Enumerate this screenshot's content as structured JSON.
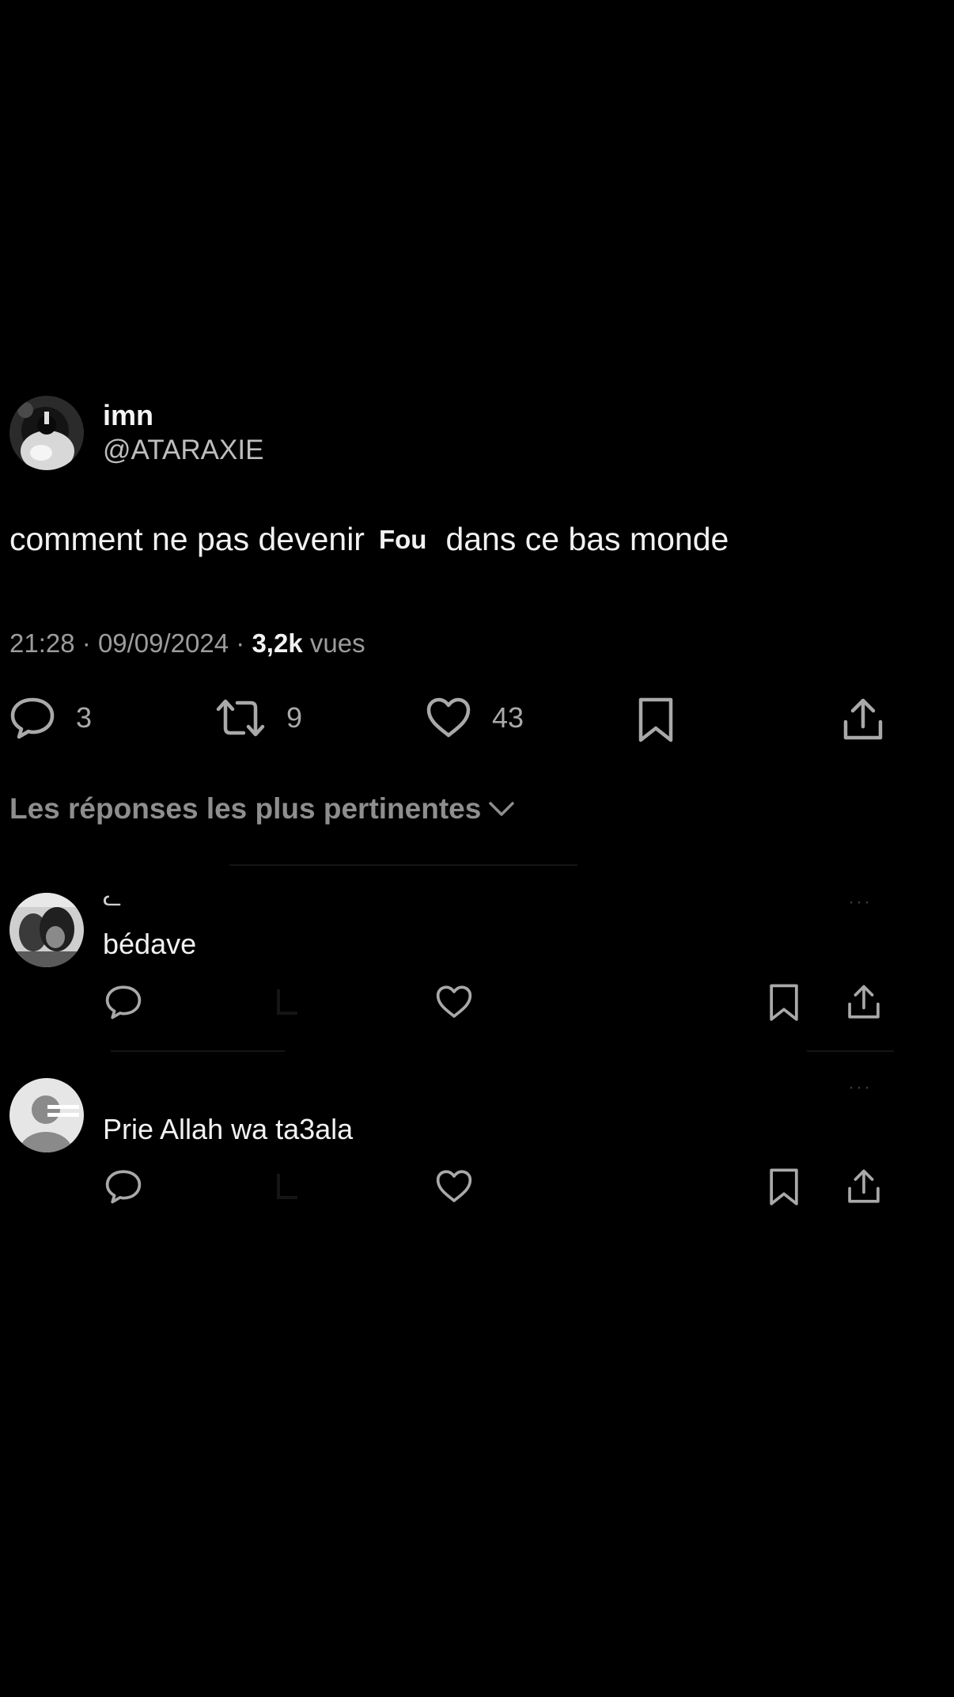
{
  "post": {
    "author_name": "imn",
    "author_handle": "@ATARAXIE",
    "text_before": "comment ne pas devenir",
    "text_emphasis": "Fou",
    "text_after": "dans ce bas monde",
    "time": "21:28",
    "date": "09/09/2024",
    "separator": "·",
    "views_count": "3,2k",
    "views_label": "vues",
    "replies": "3",
    "reposts": "9",
    "likes": "43"
  },
  "replies_section": {
    "sort_label": "Les réponses les plus pertinentes"
  },
  "replies": [
    {
      "name": "ᓚ",
      "text": "bédave",
      "more": "···"
    },
    {
      "text": "Prie Allah wa ta3ala",
      "more": "···"
    }
  ],
  "colors": {
    "background": "#000000",
    "text": "#f2f2f2",
    "muted": "#9c9c9c",
    "icon": "#a9a9a9"
  },
  "icons": {
    "reply": "speech-bubble-icon",
    "repost": "repost-arrows-icon",
    "like": "heart-icon",
    "bookmark": "bookmark-icon",
    "share": "share-upload-icon",
    "sort": "chevron-down-icon"
  }
}
